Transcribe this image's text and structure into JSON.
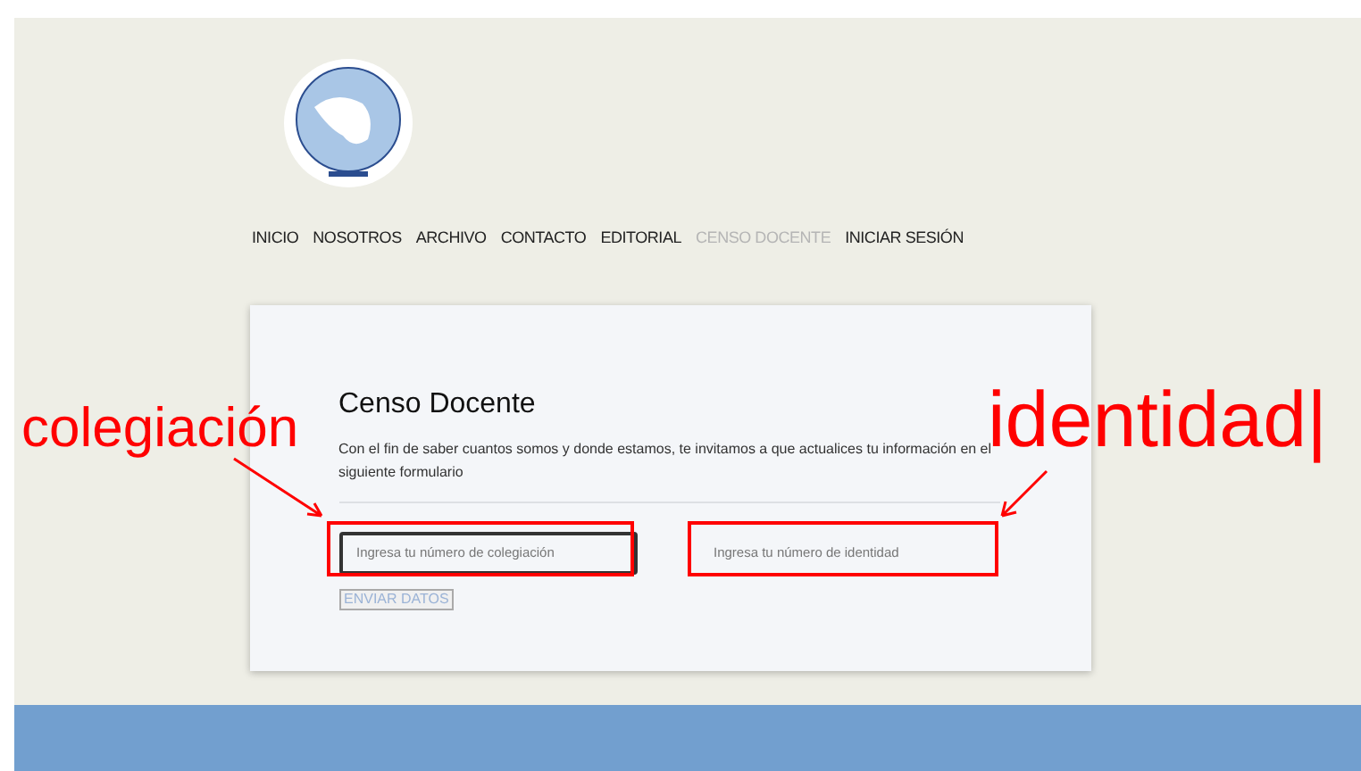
{
  "nav": [
    {
      "label": "INICIO",
      "selected": false
    },
    {
      "label": "NOSOTROS",
      "selected": false
    },
    {
      "label": "ARCHIVO",
      "selected": false
    },
    {
      "label": "CONTACTO",
      "selected": false
    },
    {
      "label": "EDITORIAL",
      "selected": false
    },
    {
      "label": "CENSO DOCENTE",
      "selected": true
    },
    {
      "label": "INICIAR SESIÓN",
      "selected": false
    }
  ],
  "form": {
    "title": "Censo Docente",
    "description": "Con el fin de saber cuantos somos y donde estamos, te invitamos a que actualices tu información en el siguiente formulario",
    "fields": [
      {
        "placeholder": "Ingresa tu número de colegiación",
        "focused": true
      },
      {
        "placeholder": "Ingresa tu número de identidad",
        "focused": false
      }
    ],
    "submit": "ENVIAR DATOS"
  },
  "annotations": [
    {
      "text": "colegiación"
    },
    {
      "text": "identidad|"
    }
  ]
}
